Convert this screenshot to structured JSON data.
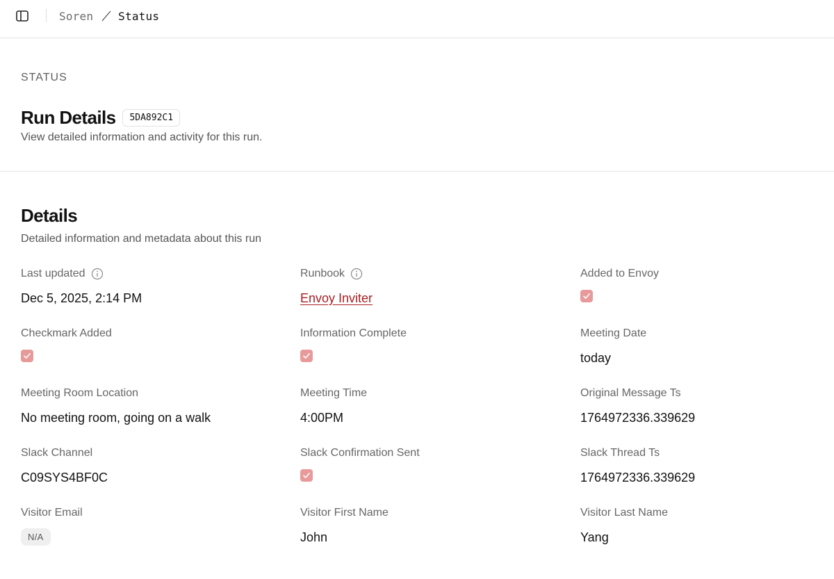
{
  "header": {
    "breadcrumb": [
      "Soren",
      "Status"
    ]
  },
  "page": {
    "eyebrow": "STATUS",
    "title": "Run Details",
    "run_id": "5DA892C1",
    "subtitle": "View detailed information and activity for this run."
  },
  "details": {
    "title": "Details",
    "subtitle": "Detailed information and metadata about this run",
    "fields": [
      {
        "label": "Last updated",
        "value": "Dec 5, 2025, 2:14 PM",
        "type": "text",
        "info": true
      },
      {
        "label": "Runbook",
        "value": "Envoy Inviter",
        "type": "link",
        "info": true
      },
      {
        "label": "Added to Envoy",
        "value": true,
        "type": "checkbox"
      },
      {
        "label": "Checkmark Added",
        "value": true,
        "type": "checkbox"
      },
      {
        "label": "Information Complete",
        "value": true,
        "type": "checkbox"
      },
      {
        "label": "Meeting Date",
        "value": "today",
        "type": "text"
      },
      {
        "label": "Meeting Room Location",
        "value": "No meeting room, going on a walk",
        "type": "text"
      },
      {
        "label": "Meeting Time",
        "value": "4:00PM",
        "type": "text"
      },
      {
        "label": "Original Message Ts",
        "value": "1764972336.339629",
        "type": "text"
      },
      {
        "label": "Slack Channel",
        "value": "C09SYS4BF0C",
        "type": "text"
      },
      {
        "label": "Slack Confirmation Sent",
        "value": true,
        "type": "checkbox"
      },
      {
        "label": "Slack Thread Ts",
        "value": "1764972336.339629",
        "type": "text"
      },
      {
        "label": "Visitor Email",
        "value": "N/A",
        "type": "badge"
      },
      {
        "label": "Visitor First Name",
        "value": "John",
        "type": "text"
      },
      {
        "label": "Visitor Last Name",
        "value": "Yang",
        "type": "text"
      }
    ]
  },
  "colors": {
    "checkbox_fill": "#e89a9a",
    "link": "#a61e22",
    "divider": "#e3e3e3"
  },
  "icons": {
    "sidebar_toggle": "sidebar-toggle-icon",
    "info": "info-icon",
    "check": "check-icon"
  }
}
